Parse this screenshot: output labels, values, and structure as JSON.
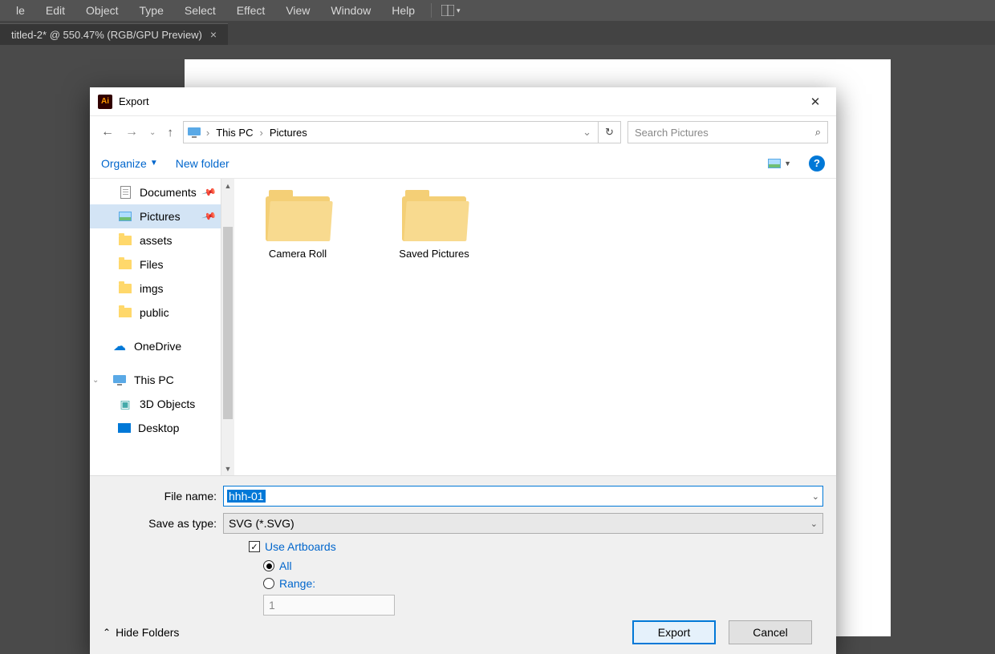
{
  "app": {
    "menu": [
      "le",
      "Edit",
      "Object",
      "Type",
      "Select",
      "Effect",
      "View",
      "Window",
      "Help"
    ],
    "tab_title": "titled-2* @ 550.47% (RGB/GPU Preview)"
  },
  "dialog": {
    "title": "Export",
    "breadcrumb": {
      "root": "This PC",
      "folder": "Pictures"
    },
    "search_placeholder": "Search Pictures",
    "toolbar": {
      "organize": "Organize",
      "new_folder": "New folder"
    },
    "tree": [
      {
        "label": "Documents",
        "icon": "doc",
        "pinned": true
      },
      {
        "label": "Pictures",
        "icon": "pic",
        "pinned": true,
        "selected": true
      },
      {
        "label": "assets",
        "icon": "folder"
      },
      {
        "label": "Files",
        "icon": "folder"
      },
      {
        "label": "imgs",
        "icon": "folder"
      },
      {
        "label": "public",
        "icon": "folder"
      },
      {
        "label": "OneDrive",
        "icon": "cloud",
        "level": 0
      },
      {
        "label": "This PC",
        "icon": "pc",
        "level": 0,
        "expand": true
      },
      {
        "label": "3D Objects",
        "icon": "3d"
      },
      {
        "label": "Desktop",
        "icon": "desktop"
      }
    ],
    "folders": [
      {
        "name": "Camera Roll"
      },
      {
        "name": "Saved Pictures"
      }
    ],
    "form": {
      "file_name_label": "File name:",
      "file_name_value": "hhh-01",
      "type_label": "Save as type:",
      "type_value": "SVG (*.SVG)",
      "use_artboards": "Use Artboards",
      "all": "All",
      "range": "Range:",
      "range_value": "1"
    },
    "buttons": {
      "hide_folders": "Hide Folders",
      "export": "Export",
      "cancel": "Cancel"
    }
  }
}
